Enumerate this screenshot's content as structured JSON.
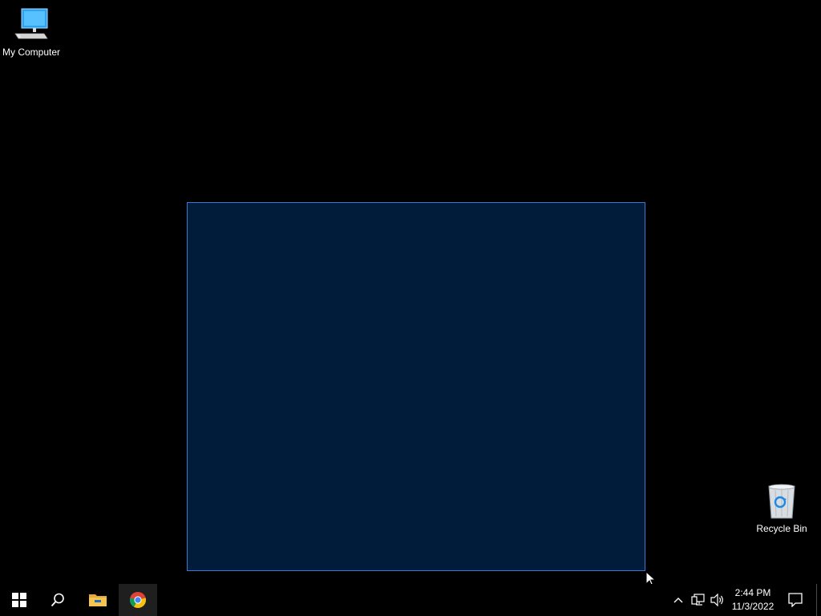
{
  "desktop": {
    "background": "#000000",
    "icons": [
      {
        "label": "My Computer",
        "icon": "monitor-icon"
      },
      {
        "label": "Recycle Bin",
        "icon": "recycle-bin-icon"
      }
    ],
    "selection": {
      "fill": "#001c3a",
      "border": "#3a78d6"
    }
  },
  "taskbar": {
    "background": "#000000",
    "pinned": [
      {
        "name": "Start",
        "icon": "windows-logo-icon"
      },
      {
        "name": "Search",
        "icon": "search-icon"
      },
      {
        "name": "File Explorer",
        "icon": "folder-icon"
      },
      {
        "name": "Google Chrome",
        "icon": "chrome-icon",
        "active": true
      }
    ],
    "tray": {
      "icons": [
        "chevron-up-icon",
        "network-icon",
        "volume-icon",
        "notification-icon"
      ],
      "time": "2:44 PM",
      "date": "11/3/2022"
    }
  }
}
